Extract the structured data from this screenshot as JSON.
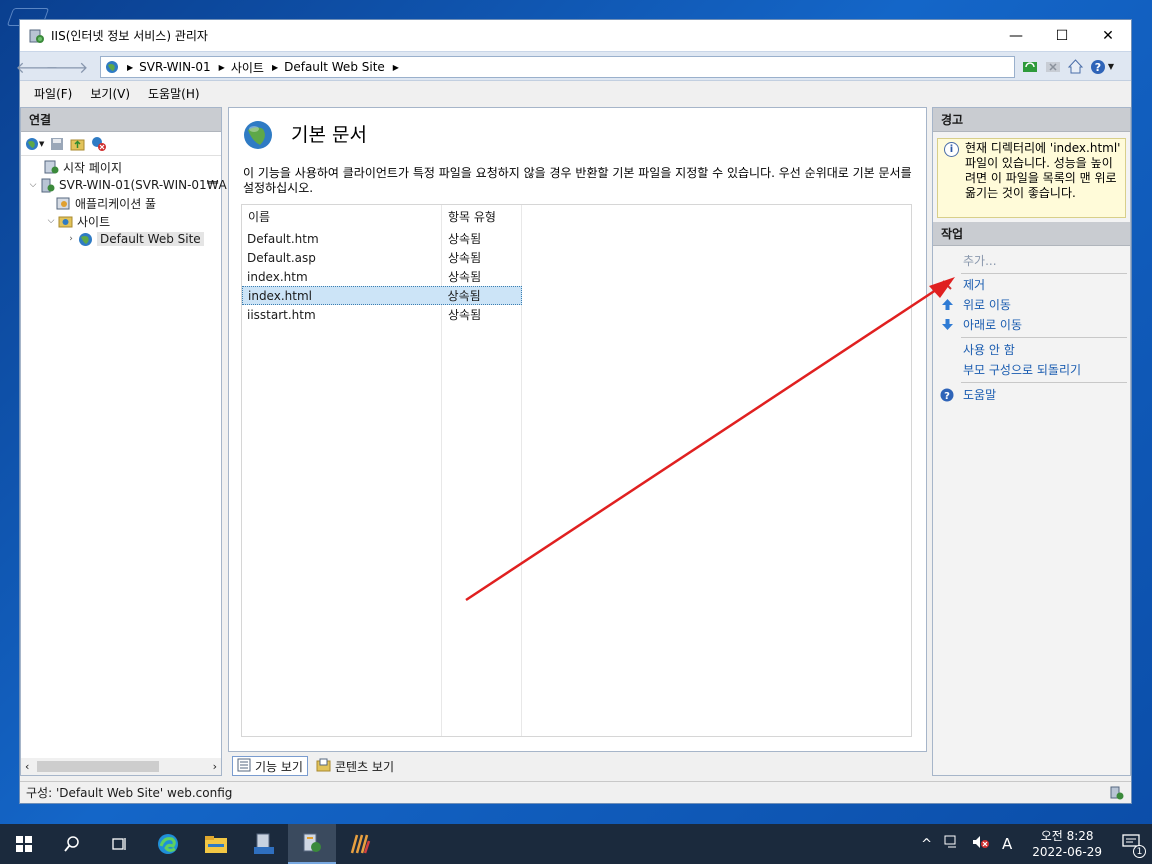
{
  "window": {
    "title": "IIS(인터넷 정보 서비스) 관리자",
    "controls": {
      "minimize": "—",
      "maximize": "☐",
      "close": "✕"
    }
  },
  "address": {
    "crumbs": [
      "SVR-WIN-01",
      "사이트",
      "Default Web Site"
    ]
  },
  "menu": [
    "파일(F)",
    "보기(V)",
    "도움말(H)"
  ],
  "connections": {
    "header": "연결",
    "tree": {
      "start_page": "시작 페이지",
      "server": "SVR-WIN-01(SVR-WIN-01₩A",
      "app_pools": "애플리케이션 풀",
      "sites": "사이트",
      "default_site": "Default Web Site"
    }
  },
  "center": {
    "title": "기본 문서",
    "description": "이 기능을 사용하여 클라이언트가 특정 파일을 요청하지 않을 경우 반환할 기본 파일을 지정할 수 있습니다. 우선 순위대로 기본 문서를 설정하십시오.",
    "columns": [
      "이름",
      "항목 유형"
    ],
    "rows": [
      {
        "name": "Default.htm",
        "type": "상속됨"
      },
      {
        "name": "Default.asp",
        "type": "상속됨"
      },
      {
        "name": "index.htm",
        "type": "상속됨"
      },
      {
        "name": "index.html",
        "type": "상속됨"
      },
      {
        "name": "iisstart.htm",
        "type": "상속됨"
      }
    ],
    "selected_row": "index.html",
    "tabs": {
      "features": "기능 보기",
      "content": "콘텐츠 보기"
    }
  },
  "right": {
    "alert_header": "경고",
    "alert_text": "현재 디렉터리에 'index.html' 파일이 있습니다. 성능을 높이려면 이 파일을 목록의 맨 위로 옮기는 것이 좋습니다.",
    "actions_header": "작업",
    "actions": {
      "add": "추가...",
      "remove": "제거",
      "move_up": "위로 이동",
      "move_down": "아래로 이동",
      "disable": "사용 안 함",
      "revert": "부모 구성으로 되돌리기",
      "help": "도움말"
    }
  },
  "status": {
    "text": "구성: 'Default Web Site' web.config"
  },
  "taskbar": {
    "ime": "A",
    "time": "오전 8:28",
    "date": "2022-06-29",
    "notification_count": "1"
  },
  "colors": {
    "arrow": "#e02020",
    "link": "#1a5cb0",
    "selection": "#cce4f7"
  }
}
